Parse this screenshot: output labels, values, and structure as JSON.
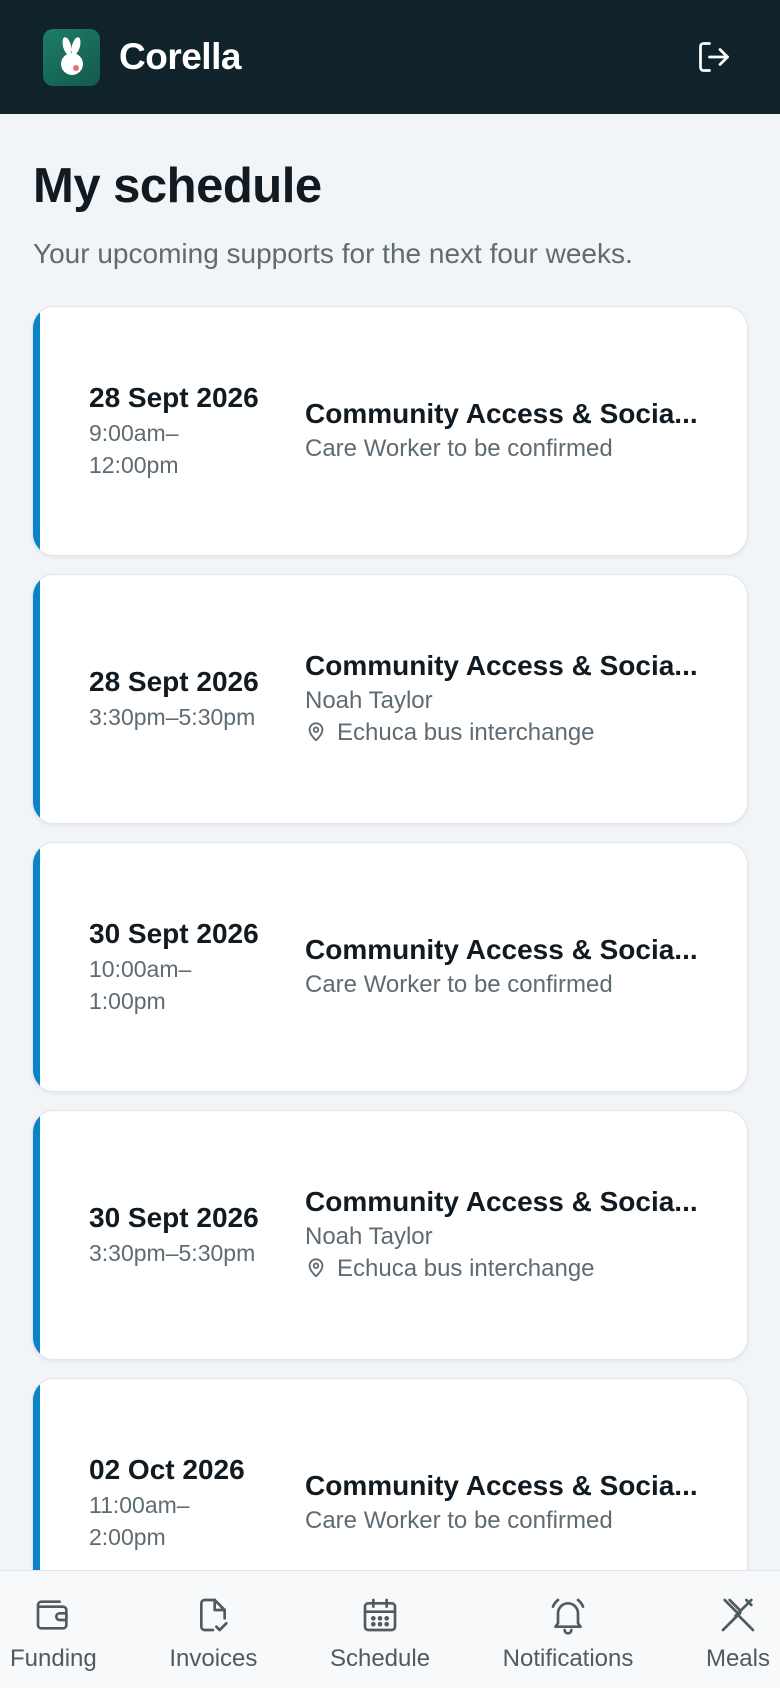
{
  "header": {
    "app_name": "Corella",
    "logo_icon": "rabbit-logo-icon",
    "logout_icon": "logout-icon"
  },
  "page": {
    "title": "My schedule",
    "subtitle": "Your upcoming supports for the next four weeks."
  },
  "colors": {
    "header_bg": "#10232a",
    "accent": "#0a83c9",
    "logo_bg": "#1d7d68",
    "page_bg": "#f2f5f7"
  },
  "appointments": [
    {
      "date": "28 Sept 2026",
      "time": "9:00am–12:00pm",
      "service": "Community Access & Socia...",
      "worker": "Care Worker to be confirmed",
      "location": ""
    },
    {
      "date": "28 Sept 2026",
      "time": "3:30pm–5:30pm",
      "service": "Community Access & Socia...",
      "worker": "Noah Taylor",
      "location": "Echuca bus interchange"
    },
    {
      "date": "30 Sept 2026",
      "time": "10:00am–1:00pm",
      "service": "Community Access & Socia...",
      "worker": "Care Worker to be confirmed",
      "location": ""
    },
    {
      "date": "30 Sept 2026",
      "time": "3:30pm–5:30pm",
      "service": "Community Access & Socia...",
      "worker": "Noah Taylor",
      "location": "Echuca bus interchange"
    },
    {
      "date": "02 Oct 2026",
      "time": "11:00am–2:00pm",
      "service": "Community Access & Socia...",
      "worker": "Care Worker to be confirmed",
      "location": ""
    }
  ],
  "bottom_nav": [
    {
      "label": "Funding",
      "icon": "wallet-icon"
    },
    {
      "label": "Invoices",
      "icon": "document-check-icon"
    },
    {
      "label": "Schedule",
      "icon": "calendar-icon"
    },
    {
      "label": "Notifications",
      "icon": "bell-icon"
    },
    {
      "label": "Meals",
      "icon": "utensils-icon"
    }
  ]
}
